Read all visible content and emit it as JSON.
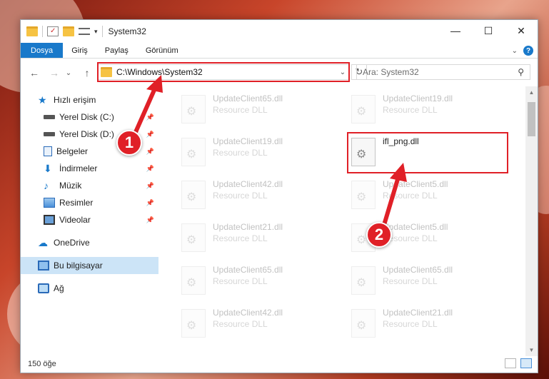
{
  "window": {
    "title": "System32"
  },
  "ribbon": {
    "tabs": [
      "Dosya",
      "Giriş",
      "Paylaş",
      "Görünüm"
    ],
    "help": "?"
  },
  "window_controls": {
    "minimize": "—",
    "maximize": "☐",
    "close": "✕"
  },
  "nav": {
    "back": "←",
    "forward": "→",
    "recent": "⌄",
    "up": "↑"
  },
  "address": {
    "path": "C:\\Windows\\System32",
    "dropdown": "⌄",
    "refresh": "↻"
  },
  "search": {
    "placeholder": "Ara: System32",
    "icon": "search-icon"
  },
  "sidebar": {
    "items": [
      {
        "label": "Hızlı erişim",
        "icon": "star-icon",
        "pinned": false
      },
      {
        "label": "Yerel Disk (C:)",
        "icon": "drive-icon",
        "pinned": true
      },
      {
        "label": "Yerel Disk (D:)",
        "icon": "drive-icon",
        "pinned": true
      },
      {
        "label": "Belgeler",
        "icon": "document-icon",
        "pinned": true
      },
      {
        "label": "İndirmeler",
        "icon": "download-icon",
        "pinned": true
      },
      {
        "label": "Müzik",
        "icon": "music-icon",
        "pinned": true
      },
      {
        "label": "Resimler",
        "icon": "pictures-icon",
        "pinned": true
      },
      {
        "label": "Videolar",
        "icon": "video-icon",
        "pinned": true
      },
      {
        "label": "OneDrive",
        "icon": "cloud-icon",
        "pinned": false
      },
      {
        "label": "Bu bilgisayar",
        "icon": "computer-icon",
        "pinned": false,
        "selected": true
      },
      {
        "label": "Ağ",
        "icon": "network-icon",
        "pinned": false
      }
    ]
  },
  "files": [
    {
      "name": "UpdateClient65.dll",
      "type": "Resource DLL"
    },
    {
      "name": "UpdateClient19.dll",
      "type": "Resource DLL"
    },
    {
      "name": "UpdateClient19.dll",
      "type": "Resource DLL"
    },
    {
      "name": "ifl_png.dll",
      "type": "",
      "highlighted": true
    },
    {
      "name": "UpdateClient42.dll",
      "type": "Resource DLL"
    },
    {
      "name": "UpdateClient5.dll",
      "type": "Resource DLL"
    },
    {
      "name": "UpdateClient21.dll",
      "type": "Resource DLL"
    },
    {
      "name": "UpdateClient5.dll",
      "type": "Resource DLL"
    },
    {
      "name": "UpdateClient65.dll",
      "type": "Resource DLL"
    },
    {
      "name": "UpdateClient65.dll",
      "type": "Resource DLL"
    },
    {
      "name": "UpdateClient42.dll",
      "type": "Resource DLL"
    },
    {
      "name": "UpdateClient21.dll",
      "type": "Resource DLL"
    }
  ],
  "status": {
    "count": "150 öğe"
  },
  "annotations": {
    "step1": "1",
    "step2": "2"
  },
  "colors": {
    "accent": "#1979ca",
    "highlight": "#e02027",
    "selected": "#cce4f7"
  }
}
